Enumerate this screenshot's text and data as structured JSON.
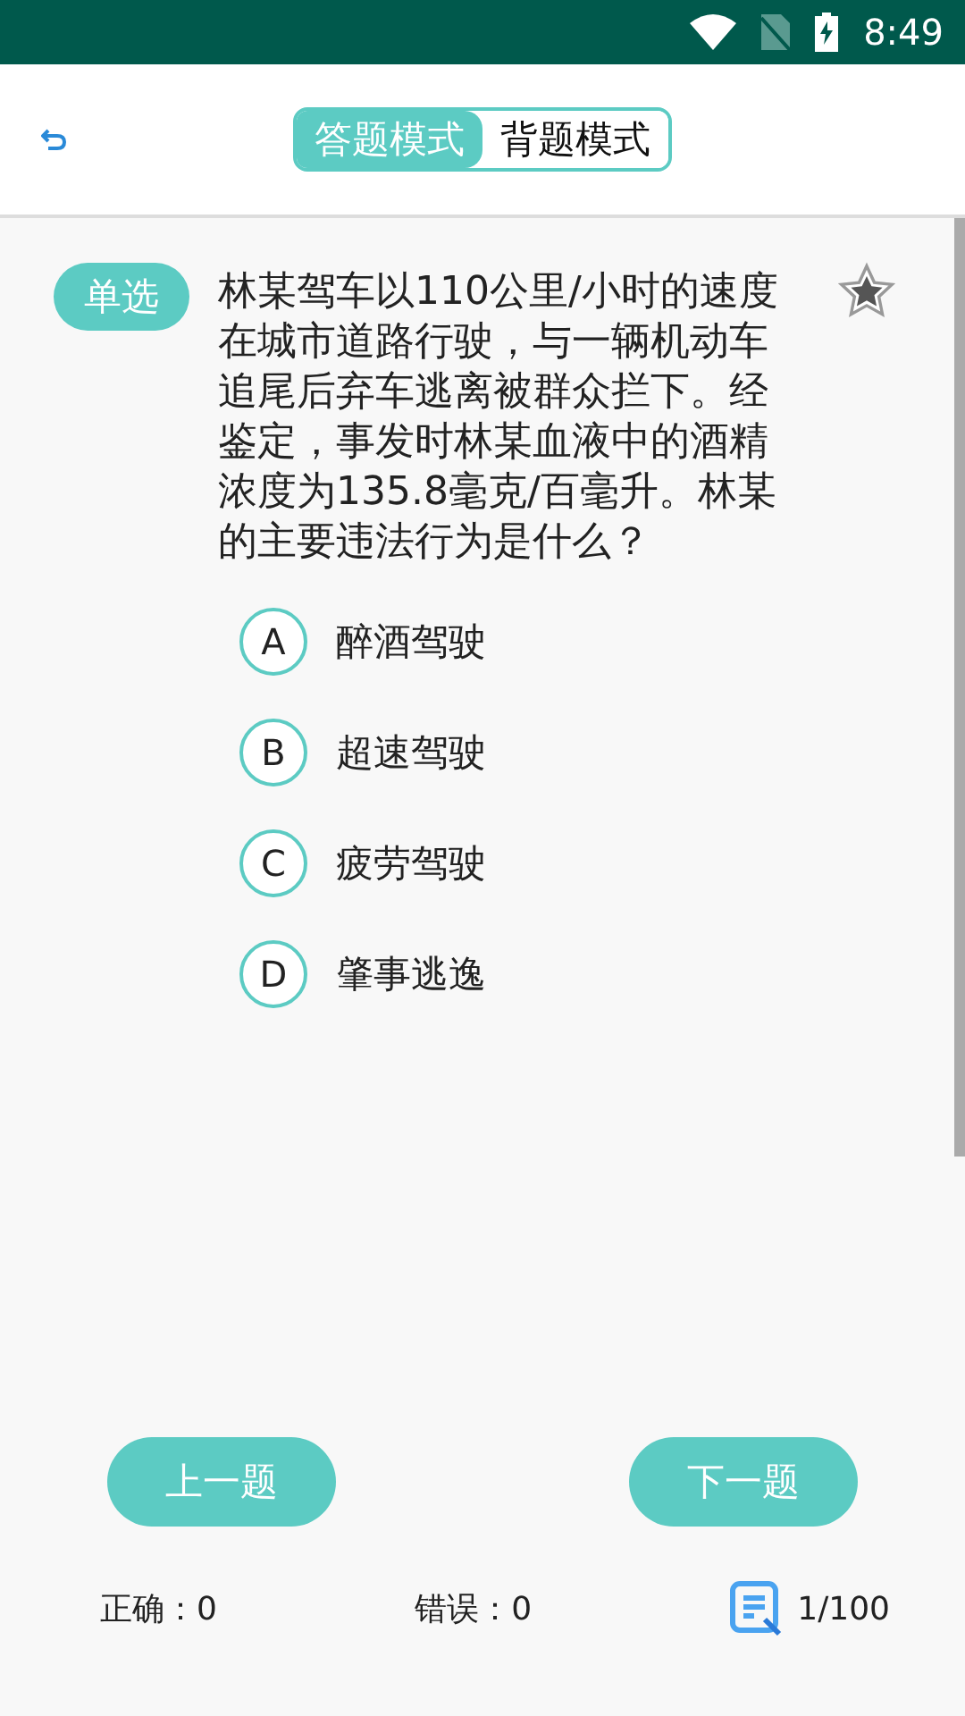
{
  "status_bar": {
    "time": "8:49"
  },
  "mode_tabs": [
    {
      "label": "答题模式",
      "selected": true
    },
    {
      "label": "背题模式",
      "selected": false
    }
  ],
  "question": {
    "type_badge": "单选",
    "text": "林某驾车以110公里/小时的速度在城市道路行驶，与一辆机动车追尾后弃车逃离被群众拦下。经鉴定，事发时林某血液中的酒精浓度为135.8毫克/百毫升。林某的主要违法行为是什么？",
    "favorited": false
  },
  "options": [
    {
      "letter": "A",
      "text": "醉酒驾驶",
      "selected": false
    },
    {
      "letter": "B",
      "text": "超速驾驶",
      "selected": false
    },
    {
      "letter": "C",
      "text": "疲劳驾驶",
      "selected": false
    },
    {
      "letter": "D",
      "text": "肇事逃逸",
      "selected": false
    }
  ],
  "buttons": {
    "prev": "上一题",
    "next": "下一题"
  },
  "footer": {
    "correct": "正确：0",
    "wrong": "错误：0",
    "progress": "1/100"
  }
}
